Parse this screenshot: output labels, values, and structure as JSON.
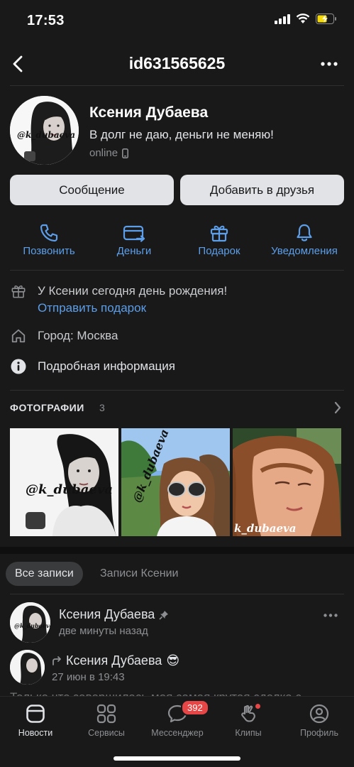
{
  "status_bar": {
    "time": "17:53"
  },
  "nav": {
    "title": "id631565625"
  },
  "profile": {
    "name": "Ксения Дубаева",
    "status": "В долг не даю, деньги не меняю!",
    "online": "online",
    "avatar_caption": "@k_dubaeva"
  },
  "buttons": {
    "message": "Сообщение",
    "add_friend": "Добавить в друзья"
  },
  "actions": [
    {
      "label": "Позвонить",
      "icon": "phone-icon"
    },
    {
      "label": "Деньги",
      "icon": "card-icon"
    },
    {
      "label": "Подарок",
      "icon": "gift-icon"
    },
    {
      "label": "Уведомления",
      "icon": "bell-icon"
    }
  ],
  "info": {
    "birthday_text": "У Ксении сегодня день рождения!",
    "birthday_link": "Отправить подарок",
    "city": "Город: Москва",
    "details": "Подробная информация"
  },
  "photos": {
    "header": "ФОТОГРАФИИ",
    "count": "3",
    "captions": [
      "@k_dubaeva",
      "@k_dubaeva",
      "k_dubaeva"
    ]
  },
  "wall_tabs": {
    "all": "Все записи",
    "own": "Записи Ксении"
  },
  "post": {
    "author": "Ксения Дубаева",
    "time": "две минуты назад",
    "repost_author": "Ксения Дубаева",
    "repost_emoji": "😎",
    "repost_time": "27 июн в 19:43",
    "text": "Только что завершилась моя самая крутая сделка с..."
  },
  "tabbar": {
    "items": [
      {
        "label": "Новости",
        "icon": "news-icon",
        "active": true
      },
      {
        "label": "Сервисы",
        "icon": "services-icon"
      },
      {
        "label": "Мессенджер",
        "icon": "messenger-icon",
        "badge": "392"
      },
      {
        "label": "Клипы",
        "icon": "clips-icon"
      },
      {
        "label": "Профиль",
        "icon": "profile-icon"
      }
    ]
  },
  "colors": {
    "accent": "#5d9ee8",
    "background": "#19191a",
    "badge": "#e64646"
  }
}
